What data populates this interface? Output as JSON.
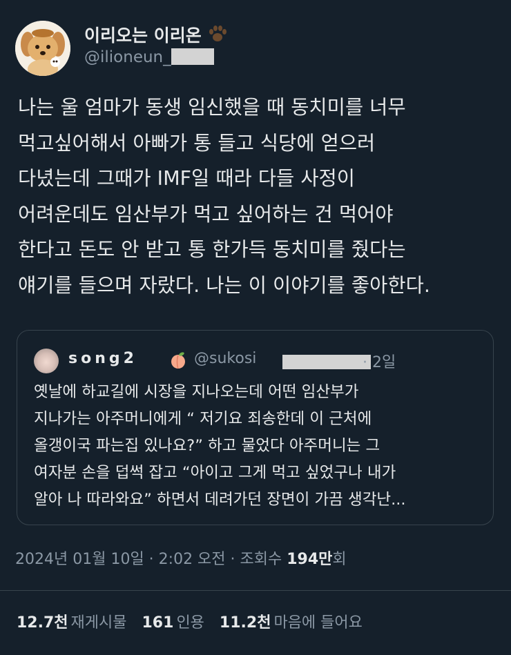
{
  "author": {
    "display_name": "이리오는 이리온",
    "handle": "@ilioneun_"
  },
  "tweet": {
    "lines": [
      "나는 울 엄마가 동생 임신했을 때 동치미를 너무",
      "먹고싶어해서 아빠가 통 들고 식당에 얻으러",
      "다녔는데 그때가 IMF일 때라 다들 사정이",
      "어려운데도 임산부가 먹고 싶어하는 건 먹어야",
      "한다고 돈도 안 받고 통 한가득 동치미를 줬다는",
      "얘기를 들으며 자랐다. 나는 이 이야기를 좋아한다."
    ]
  },
  "quote": {
    "name": "song2",
    "handle": "@sukosi",
    "time": "· 2일",
    "lines": [
      "옛날에 하교길에 시장을 지나오는데 어떤 임산부가",
      "지나가는 아주머니에게 “ 저기요 죄송한데 이 근처에",
      "올갱이국 파는집 있나요?” 하고 물었다 아주머니는 그",
      "여자분 손을 덥썩 잡고 “아이고 그게 먹고 싶었구나 내가",
      "알아 나 따라와요” 하면서 데려가던 장면이 가끔 생각난..."
    ]
  },
  "meta": {
    "datetime": "2024년 01월 10일 · 2:02 오전 · 조회수 ",
    "views": "194만",
    "views_suffix": "회"
  },
  "stats": {
    "retweets_count": "12.7천",
    "retweets_label": "재게시물",
    "quotes_count": "161",
    "quotes_label": "인용",
    "likes_count": "11.2천",
    "likes_label": "마음에 들어요"
  },
  "icons": {
    "paw": "paw-icon",
    "peach": "peach-icon"
  },
  "colors": {
    "background": "#15202b",
    "text": "#e7e9ea",
    "secondary": "#8b98a5",
    "border": "#38444d"
  }
}
